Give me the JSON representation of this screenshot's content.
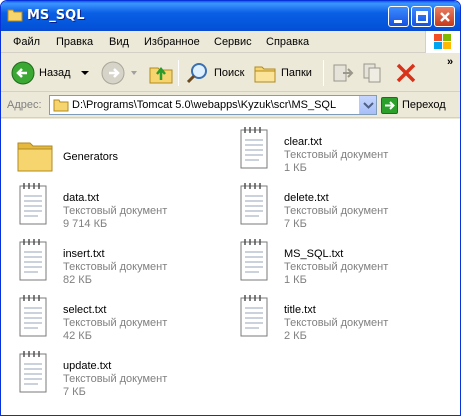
{
  "window": {
    "title": "MS_SQL",
    "controls": [
      "minimize",
      "maximize",
      "close"
    ]
  },
  "menu": [
    "Файл",
    "Правка",
    "Вид",
    "Избранное",
    "Сервис",
    "Справка"
  ],
  "toolbar": {
    "back_label": "Назад",
    "search_label": "Поиск",
    "folders_label": "Папки",
    "more": "»"
  },
  "address": {
    "label": "Адрес:",
    "value": "D:\\Programs\\Tomcat 5.0\\webapps\\Kyzuk\\scr\\MS_SQL",
    "go_label": "Переход"
  },
  "items": [
    {
      "name": "Generators",
      "kind": "folder",
      "type": "",
      "size": ""
    },
    {
      "name": "clear.txt",
      "kind": "file",
      "type": "Текстовый документ",
      "size": "1 КБ"
    },
    {
      "name": "data.txt",
      "kind": "file",
      "type": "Текстовый документ",
      "size": "9 714 КБ"
    },
    {
      "name": "delete.txt",
      "kind": "file",
      "type": "Текстовый документ",
      "size": "7 КБ"
    },
    {
      "name": "insert.txt",
      "kind": "file",
      "type": "Текстовый документ",
      "size": "82 КБ"
    },
    {
      "name": "MS_SQL.txt",
      "kind": "file",
      "type": "Текстовый документ",
      "size": "1 КБ"
    },
    {
      "name": "select.txt",
      "kind": "file",
      "type": "Текстовый документ",
      "size": "42 КБ"
    },
    {
      "name": "title.txt",
      "kind": "file",
      "type": "Текстовый документ",
      "size": "2 КБ"
    },
    {
      "name": "update.txt",
      "kind": "file",
      "type": "Текстовый документ",
      "size": "7 КБ"
    }
  ]
}
